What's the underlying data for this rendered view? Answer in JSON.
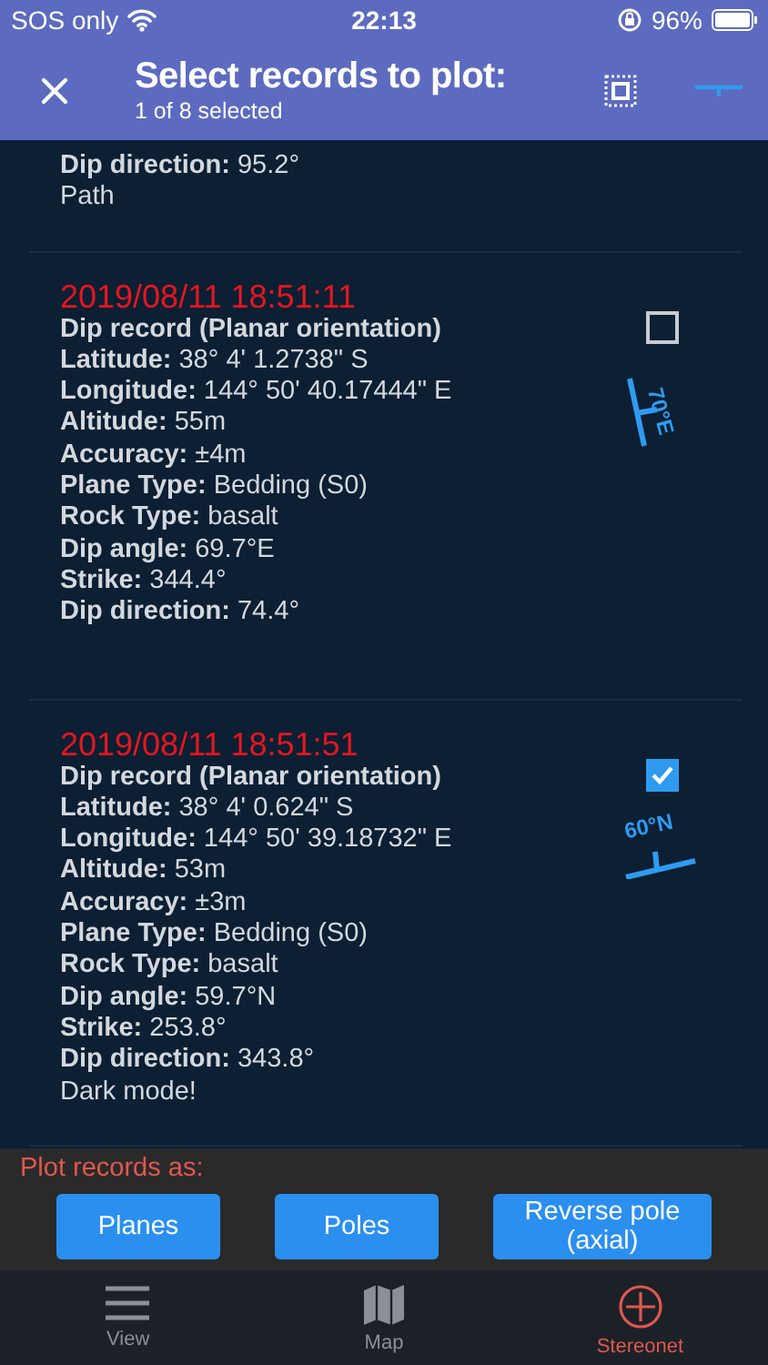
{
  "status_bar": {
    "carrier": "SOS only",
    "time": "22:13",
    "battery": "96%"
  },
  "header": {
    "title": "Select records to plot:",
    "subtitle": "1 of 8 selected"
  },
  "records": [
    {
      "fields": [
        {
          "label": "Dip direction:",
          "value": "95.2°"
        }
      ],
      "note": "Path"
    },
    {
      "timestamp": "2019/08/11 18:51:11",
      "type": "Dip record (Planar orientation)",
      "fields": [
        {
          "label": "Latitude:",
          "value": "38° 4' 1.2738\" S"
        },
        {
          "label": "Longitude:",
          "value": "144° 50' 40.17444\" E"
        },
        {
          "label": "Altitude:",
          "value": "55m"
        },
        {
          "label": "Accuracy:",
          "value": "±4m"
        },
        {
          "label": "Plane Type:",
          "value": "Bedding (S0)"
        },
        {
          "label": "Rock Type:",
          "value": "basalt"
        },
        {
          "label": "Dip angle:",
          "value": "69.7°E"
        },
        {
          "label": "Strike:",
          "value": "344.4°"
        },
        {
          "label": "Dip direction:",
          "value": "74.4°"
        }
      ],
      "checked": false,
      "symbol": {
        "kind": "vertical",
        "label": "70°E"
      }
    },
    {
      "timestamp": "2019/08/11 18:51:51",
      "type": "Dip record (Planar orientation)",
      "fields": [
        {
          "label": "Latitude:",
          "value": "38° 4' 0.624\" S"
        },
        {
          "label": "Longitude:",
          "value": "144° 50' 39.18732\" E"
        },
        {
          "label": "Altitude:",
          "value": "53m"
        },
        {
          "label": "Accuracy:",
          "value": "±3m"
        },
        {
          "label": "Plane Type:",
          "value": "Bedding (S0)"
        },
        {
          "label": "Rock Type:",
          "value": "basalt"
        },
        {
          "label": "Dip angle:",
          "value": "59.7°N"
        },
        {
          "label": "Strike:",
          "value": "253.8°"
        },
        {
          "label": "Dip direction:",
          "value": "343.8°"
        }
      ],
      "note": "Dark mode!",
      "checked": true,
      "symbol": {
        "kind": "horizontal",
        "label": "60°N"
      }
    }
  ],
  "plot_panel": {
    "label": "Plot records as:",
    "buttons": [
      "Planes",
      "Poles",
      "Reverse pole (axial)"
    ]
  },
  "tab_bar": [
    {
      "kind": "menu",
      "label": "View",
      "selected": false
    },
    {
      "kind": "map",
      "label": "Map",
      "selected": false
    },
    {
      "kind": "stereonet",
      "label": "Stereonet",
      "selected": true
    }
  ]
}
